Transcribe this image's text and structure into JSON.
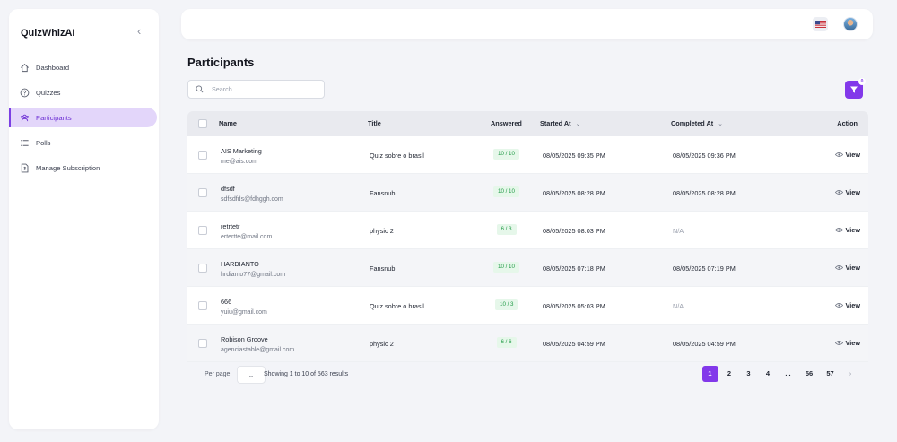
{
  "brand": "QuizWhizAI",
  "sidebar": {
    "collapse_icon": "chevron-left-icon",
    "items": [
      {
        "label": "Dashboard",
        "icon": "home-icon"
      },
      {
        "label": "Quizzes",
        "icon": "question-circle-icon"
      },
      {
        "label": "Participants",
        "icon": "users-icon",
        "active": true
      },
      {
        "label": "Polls",
        "icon": "list-icon"
      },
      {
        "label": "Manage Subscription",
        "icon": "document-icon"
      }
    ]
  },
  "topbar": {
    "flag_icon": "us-flag-icon",
    "avatar_icon": "user-avatar"
  },
  "page_title": "Participants",
  "search": {
    "placeholder": "Search",
    "value": ""
  },
  "filter": {
    "badge": "0",
    "icon": "filter-icon"
  },
  "table": {
    "headers": {
      "name": "Name",
      "title": "Title",
      "answered": "Answered",
      "started": "Started At",
      "completed": "Completed At",
      "action": "Action"
    },
    "rows": [
      {
        "name": "AIS Marketing",
        "email": "me@ais.com",
        "title": "Quiz sobre o brasil",
        "answered": "10 / 10",
        "started": "08/05/2025 09:35 PM",
        "completed": "08/05/2025 09:36 PM",
        "action": "View"
      },
      {
        "name": "dfsdf",
        "email": "sdfsdfds@fdhggh.com",
        "title": "Fansnub",
        "answered": "10 / 10",
        "started": "08/05/2025 08:28 PM",
        "completed": "08/05/2025 08:28 PM",
        "action": "View"
      },
      {
        "name": "retrtetr",
        "email": "ertertte@mail.com",
        "title": "physic 2",
        "answered": "6 / 3",
        "started": "08/05/2025 08:03 PM",
        "completed": "N/A",
        "action": "View"
      },
      {
        "name": "HARDIANTO",
        "email": "hrdianto77@gmail.com",
        "title": "Fansnub",
        "answered": "10 / 10",
        "started": "08/05/2025 07:18 PM",
        "completed": "08/05/2025 07:19 PM",
        "action": "View"
      },
      {
        "name": "666",
        "email": "yuiu@gmail.com",
        "title": "Quiz sobre o brasil",
        "answered": "10 / 3",
        "started": "08/05/2025 05:03 PM",
        "completed": "N/A",
        "action": "View"
      },
      {
        "name": "Robison Groove",
        "email": "agenciastable@gmail.com",
        "title": "physic 2",
        "answered": "6 / 6",
        "started": "08/05/2025 04:59 PM",
        "completed": "08/05/2025 04:59 PM",
        "action": "View"
      }
    ]
  },
  "footer": {
    "per_page_label": "Per page",
    "per_page_value": "",
    "showing": "Showing 1 to 10 of 563 results",
    "pages": [
      "1",
      "2",
      "3",
      "4",
      "...",
      "56",
      "57"
    ],
    "next": "›"
  }
}
